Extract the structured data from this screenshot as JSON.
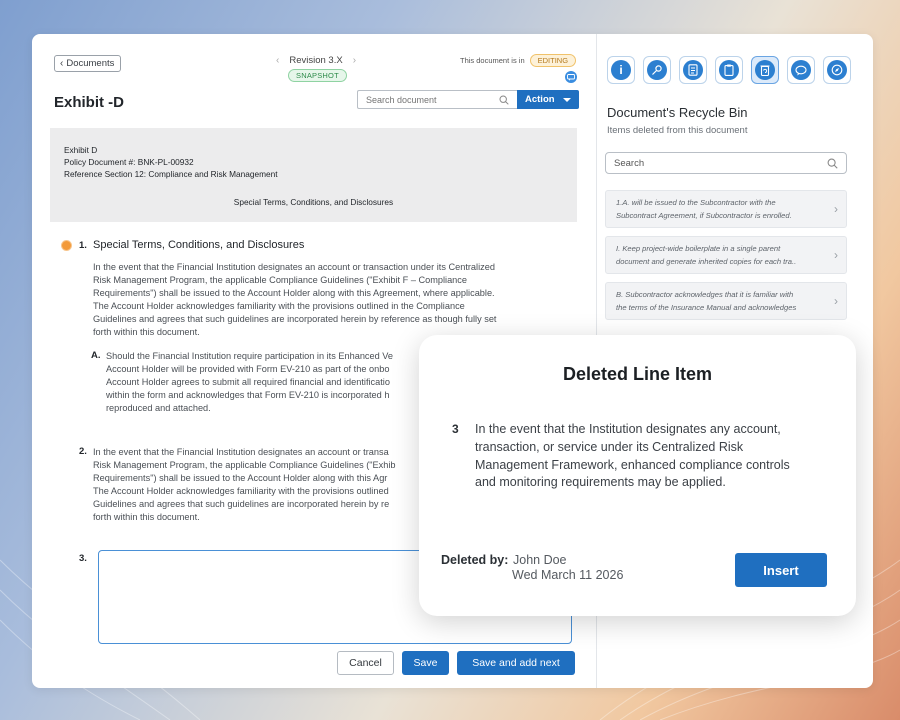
{
  "header": {
    "back_label": "Documents",
    "revision": "Revision 3.X",
    "snapshot": "SNAPSHOT",
    "status_prefix": "This document is in",
    "status_badge": "EDITING",
    "title": "Exhibit -D",
    "search_placeholder": "Search document",
    "action_label": "Action"
  },
  "doc_header": {
    "line1": "Exhibit D",
    "line2": "Policy Document #: BNK-PL-00932",
    "line3": "Reference Section 12: Compliance and Risk Management",
    "center": "Special Terms, Conditions, and Disclosures"
  },
  "sections": {
    "s1": {
      "num": "1.",
      "heading": "Special Terms, Conditions, and Disclosures",
      "lines": [
        "In the event that the Financial Institution designates an account or transaction under its Centralized",
        "Risk Management Program, the applicable Compliance Guidelines (\"Exhibit F – Compliance",
        "Requirements\") shall be issued to the Account Holder along with this Agreement, where applicable.",
        "The Account Holder acknowledges familiarity with the provisions outlined in the Compliance",
        "Guidelines and agrees that such guidelines are incorporated herein by reference as though fully set",
        "forth within this document."
      ]
    },
    "sA": {
      "num": "A.",
      "lines": [
        "Should the Financial Institution require participation in its Enhanced Ve",
        "Account Holder will be provided with Form EV-210 as part of the onbo",
        "Account Holder agrees to submit all required financial and identificatio",
        "within the form and acknowledges that Form EV-210 is incorporated h",
        "reproduced and attached."
      ]
    },
    "s2": {
      "num": "2.",
      "lines": [
        "In the event that the Financial Institution designates an account or transa",
        "Risk Management Program, the applicable Compliance Guidelines (\"Exhib",
        "Requirements\") shall be issued to the Account Holder along with this Agr",
        "The Account Holder acknowledges familiarity with the provisions outlined",
        "Guidelines and agrees that such guidelines are incorporated herein by re",
        "forth within this document."
      ]
    },
    "s3": {
      "num": "3."
    }
  },
  "buttons": {
    "cancel": "Cancel",
    "save": "Save",
    "save_next": "Save and add next"
  },
  "recycle": {
    "title": "Document's Recycle Bin",
    "subtitle": "Items deleted from this document",
    "search_placeholder": "Search",
    "items": [
      {
        "line1": "1.A. will be issued to the Subcontractor with the",
        "line2": "Subcontract Agreement, if Subcontractor is enrolled."
      },
      {
        "line1": "I. Keep project-wide boilerplate in a single parent",
        "line2": "document and generate inherited copies for each tra.."
      },
      {
        "line1": "B. Subcontractor acknowledges that it is familiar with",
        "line2": "the terms of the Insurance Manual and acknowledges"
      }
    ]
  },
  "modal": {
    "title": "Deleted Line Item",
    "num": "3",
    "lines": [
      "In the event that the Institution designates any account,",
      "transaction, or service under its Centralized Risk",
      "Management Framework, enhanced compliance controls",
      "and monitoring requirements may be applied."
    ],
    "deleted_by_label": "Deleted by:",
    "deleted_by_name": "John Doe",
    "deleted_date": "Wed March 11 2026",
    "insert_label": "Insert"
  },
  "colors": {
    "accent": "#1f6fc0",
    "editing": "#f0c26a",
    "snapshot": "#2e8b4a"
  }
}
